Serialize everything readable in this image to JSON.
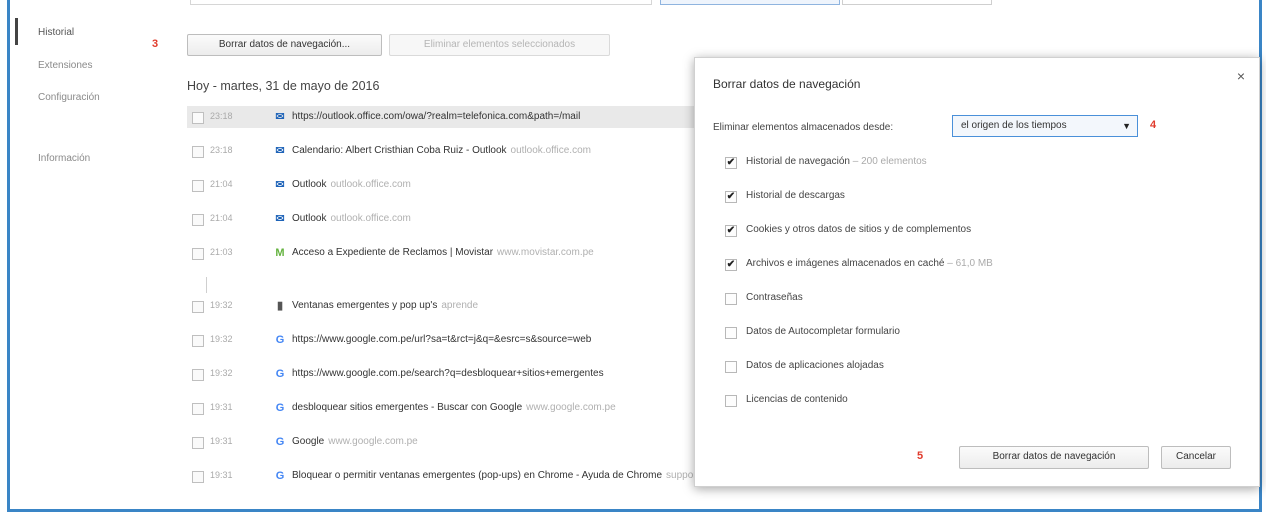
{
  "sidebar": {
    "items": [
      {
        "label": "Historial",
        "active": true
      },
      {
        "label": "Extensiones",
        "active": false
      },
      {
        "label": "Configuración",
        "active": false
      },
      {
        "label": "Información",
        "active": false
      }
    ]
  },
  "steps": {
    "s3": "3",
    "s4": "4",
    "s5": "5"
  },
  "toolbar": {
    "clear_label": "Borrar datos de navegación...",
    "remove_label": "Eliminar elementos seleccionados"
  },
  "history": {
    "date_heading": "Hoy - martes, 31 de mayo de 2016",
    "rows": [
      {
        "time": "23:18",
        "icon": "mail-icon",
        "title": "https://outlook.office.com/owa/?realm=telefonica.com&path=/mail",
        "domain": ""
      },
      {
        "time": "23:18",
        "icon": "mail-icon",
        "title": "Calendario: Albert Cristhian Coba Ruiz - Outlook",
        "domain": "outlook.office.com"
      },
      {
        "time": "21:04",
        "icon": "mail-icon",
        "title": "Outlook",
        "domain": "outlook.office.com"
      },
      {
        "time": "21:04",
        "icon": "mail-icon",
        "title": "Outlook",
        "domain": "outlook.office.com"
      },
      {
        "time": "21:03",
        "icon": "movistar-icon",
        "title": "Acceso a Expediente de Reclamos | Movistar",
        "domain": "www.movistar.com.pe"
      },
      {
        "time": "19:32",
        "icon": "bar-icon",
        "title": "Ventanas emergentes y pop up's",
        "domain": "aprende"
      },
      {
        "time": "19:32",
        "icon": "google-icon",
        "title": "https://www.google.com.pe/url?sa=t&rct=j&q=&esrc=s&source=web",
        "domain": ""
      },
      {
        "time": "19:32",
        "icon": "google-icon",
        "title": "https://www.google.com.pe/search?q=desbloquear+sitios+emergentes",
        "domain": ""
      },
      {
        "time": "19:31",
        "icon": "google-icon",
        "title": "desbloquear sitios emergentes - Buscar con Google",
        "domain": "www.google.com.pe"
      },
      {
        "time": "19:31",
        "icon": "google-icon",
        "title": "Google",
        "domain": "www.google.com.pe"
      },
      {
        "time": "19:31",
        "icon": "google-icon",
        "title": "Bloquear o permitir ventanas emergentes (pop-ups) en Chrome - Ayuda de Chrome",
        "domain": "support.google.com"
      }
    ]
  },
  "dialog": {
    "title": "Borrar datos de navegación",
    "close": "×",
    "range_label": "Eliminar elementos almacenados desde:",
    "range_value": "el origen de los tiempos",
    "options": [
      {
        "label": "Historial de navegación",
        "count": "– 200 elementos",
        "checked": true
      },
      {
        "label": "Historial de descargas",
        "count": "",
        "checked": true
      },
      {
        "label": "Cookies y otros datos de sitios y de complementos",
        "count": "",
        "checked": true
      },
      {
        "label": "Archivos e imágenes almacenados en caché",
        "count": "– 61,0 MB",
        "checked": true
      },
      {
        "label": "Contraseñas",
        "count": "",
        "checked": false
      },
      {
        "label": "Datos de Autocompletar formulario",
        "count": "",
        "checked": false
      },
      {
        "label": "Datos de aplicaciones alojadas",
        "count": "",
        "checked": false
      },
      {
        "label": "Licencias de contenido",
        "count": "",
        "checked": false
      }
    ],
    "confirm_label": "Borrar datos de navegación",
    "cancel_label": "Cancelar"
  },
  "colors": {
    "frame": "#3a85c6",
    "step": "#e03b2c",
    "select_border": "#4a90d9"
  }
}
